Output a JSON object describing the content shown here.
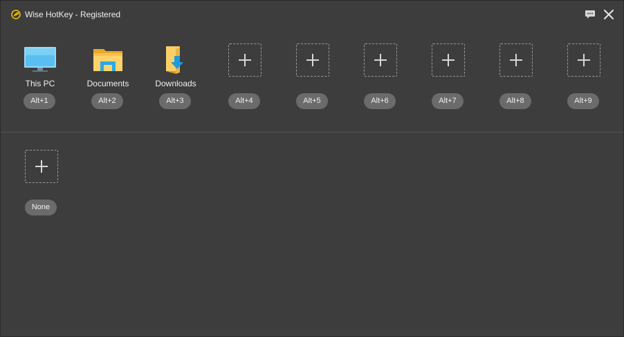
{
  "window": {
    "title": "Wise HotKey - Registered"
  },
  "icons": {
    "app": "hotkey-app-icon",
    "feedback": "chat-bubble-icon",
    "close": "close-icon",
    "accent": "#f5c400"
  },
  "row1": [
    {
      "label": "This PC",
      "hotkey": "Alt+1",
      "icon": "monitor-icon"
    },
    {
      "label": "Documents",
      "hotkey": "Alt+2",
      "icon": "folder-icon"
    },
    {
      "label": "Downloads",
      "hotkey": "Alt+3",
      "icon": "downloads-folder-icon"
    },
    {
      "label": "",
      "hotkey": "Alt+4",
      "icon": "add-icon"
    },
    {
      "label": "",
      "hotkey": "Alt+5",
      "icon": "add-icon"
    },
    {
      "label": "",
      "hotkey": "Alt+6",
      "icon": "add-icon"
    },
    {
      "label": "",
      "hotkey": "Alt+7",
      "icon": "add-icon"
    },
    {
      "label": "",
      "hotkey": "Alt+8",
      "icon": "add-icon"
    },
    {
      "label": "",
      "hotkey": "Alt+9",
      "icon": "add-icon"
    }
  ],
  "row2": [
    {
      "label": "",
      "hotkey": "None",
      "icon": "add-icon"
    }
  ]
}
